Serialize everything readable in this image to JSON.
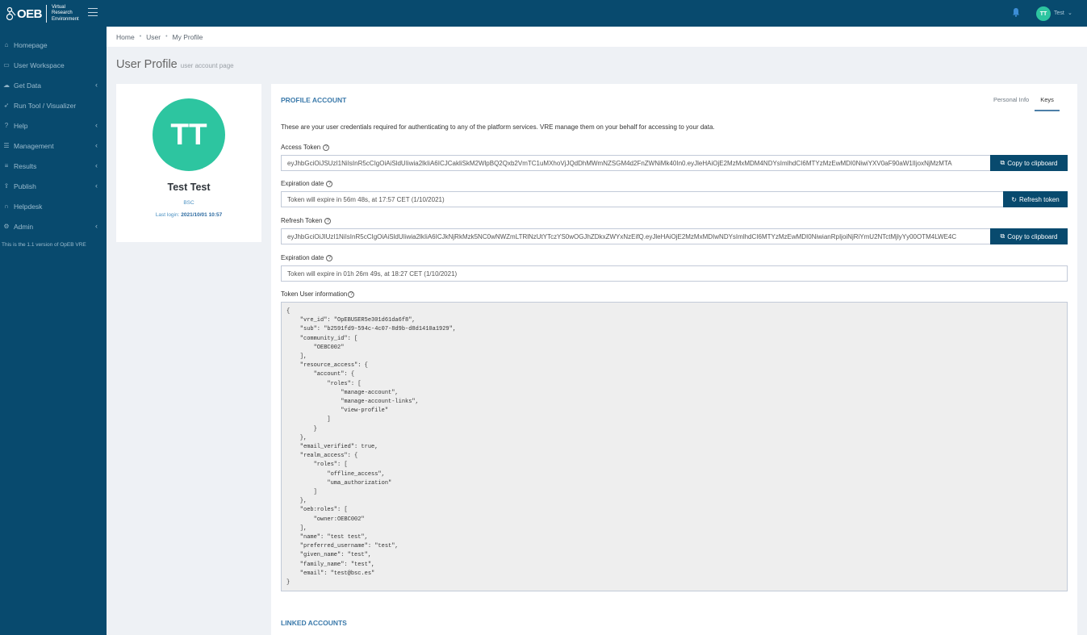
{
  "header": {
    "logo_mark": "OEB",
    "logo_lines": [
      "Virtual",
      "Research",
      "Environment"
    ],
    "user_initials": "TT",
    "user_name": "Test"
  },
  "sidebar": {
    "items": [
      {
        "label": "Homepage",
        "icon": "home-icon",
        "has_caret": false
      },
      {
        "label": "User Workspace",
        "icon": "desktop-icon",
        "has_caret": false
      },
      {
        "label": "Get Data",
        "icon": "cloud-upload-icon",
        "has_caret": true
      },
      {
        "label": "Run Tool / Visualizer",
        "icon": "rocket-icon",
        "has_caret": false
      },
      {
        "label": "Help",
        "icon": "question-icon",
        "has_caret": true
      },
      {
        "label": "Management",
        "icon": "server-icon",
        "has_caret": true
      },
      {
        "label": "Results",
        "icon": "list-icon",
        "has_caret": true
      },
      {
        "label": "Publish",
        "icon": "upload-user-icon",
        "has_caret": true
      },
      {
        "label": "Helpdesk",
        "icon": "headset-icon",
        "has_caret": false
      },
      {
        "label": "Admin",
        "icon": "gear-icon",
        "has_caret": true
      }
    ],
    "version_text": "This is the 1.1 version of OpEB VRE"
  },
  "breadcrumb": {
    "items": [
      "Home",
      "User",
      "My Profile"
    ]
  },
  "page": {
    "title": "User Profile",
    "subtitle": "user account page"
  },
  "profile": {
    "initials": "TT",
    "name": "Test Test",
    "org": "BSC",
    "last_login_label": "Last login:",
    "last_login_value": "2021/10/01 10:57"
  },
  "panel": {
    "title": "PROFILE ACCOUNT",
    "tabs": [
      {
        "label": "Personal Info",
        "active": false
      },
      {
        "label": "Keys",
        "active": true
      }
    ],
    "intro": "These are your user credentials required for authenticating to any of the platform services. VRE manage them on your behalf for accessing to your data.",
    "access_token": {
      "label": "Access Token",
      "value": "eyJhbGciOiJSUzI1NiIsInR5cCIgOiAiSldUIiwia2lkIiA6ICJCakliSkM2WlpBQ2Qxb2VmTC1uMXhoVjJQdDhMWmNZSGM4d2FnZWNiMk40In0.eyJleHAiOjE2MzMxMDM4NDYsImlhdCI6MTYzMzEwMDI0NiwiYXV0aF90aW1lIjoxNjMzMTA",
      "button": "Copy to clipboard"
    },
    "access_expiration": {
      "label": "Expiration date",
      "value": "Token will expire in 56m 48s, at 17:57 CET (1/10/2021)",
      "button": "Refresh token"
    },
    "refresh_token": {
      "label": "Refresh Token",
      "value": "eyJhbGciOiJIUzI1NiIsInR5cCIgOiAiSldUIiwia2lkIiA6ICJkNjRkMzk5NC0wNWZmLTRlNzUtYTczYS0wOGJhZDkxZWYxNzEifQ.eyJleHAiOjE2MzMxMDIwNDYsImlhdCI6MTYzMzEwMDI0NiwianRpIjoiNjRiYmU2NTctMjlyYy00OTM4LWE4C",
      "button": "Copy to clipboard"
    },
    "refresh_expiration": {
      "label": "Expiration date",
      "value": "Token will expire in 01h 26m 49s, at 18:27 CET (1/10/2021)"
    },
    "token_info": {
      "label": "Token User information",
      "json_text": "{\n    \"vre_id\": \"OpEBUSER5e301d61da6f8\",\n    \"sub\": \"b2591fd9-594c-4c07-8d9b-d8d1410a1929\",\n    \"community_id\": [\n        \"OEBC002\"\n    ],\n    \"resource_access\": {\n        \"account\": {\n            \"roles\": [\n                \"manage-account\",\n                \"manage-account-links\",\n                \"view-profile\"\n            ]\n        }\n    },\n    \"email_verified\": true,\n    \"realm_access\": {\n        \"roles\": [\n            \"offline_access\",\n            \"uma_authorization\"\n        ]\n    },\n    \"oeb:roles\": [\n        \"owner:OEBC002\"\n    ],\n    \"name\": \"test test\",\n    \"preferred_username\": \"test\",\n    \"given_name\": \"test\",\n    \"family_name\": \"test\",\n    \"email\": \"test@bsc.es\"\n}"
    },
    "linked_accounts_title": "LINKED ACCOUNTS"
  }
}
